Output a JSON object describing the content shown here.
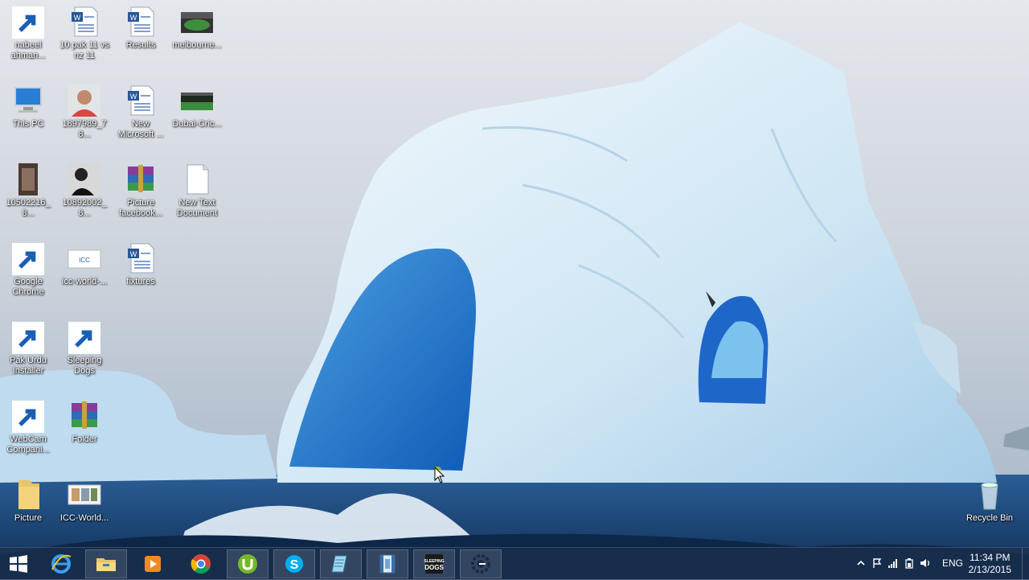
{
  "desktop": {
    "icons": [
      {
        "label": "nabeel\nahman...",
        "icon": "user-folder-icon"
      },
      {
        "label": "10 pak 11 vs\nnz 11",
        "icon": "word-document-icon"
      },
      {
        "label": "Results",
        "icon": "word-document-icon"
      },
      {
        "label": "melbourne...",
        "icon": "stadium-image-icon"
      },
      {
        "label": "This PC",
        "icon": "computer-icon"
      },
      {
        "label": "1897989_78...",
        "icon": "photo-portrait-icon"
      },
      {
        "label": "New\nMicrosoft ...",
        "icon": "word-document-icon"
      },
      {
        "label": "Dubai-Cric...",
        "icon": "stadium-image-icon"
      },
      {
        "label": "10502216_8...",
        "icon": "photo-portrait-icon"
      },
      {
        "label": "10892002_8...",
        "icon": "photo-portrait-icon"
      },
      {
        "label": "Picture\nfacebook...",
        "icon": "winrar-archive-icon"
      },
      {
        "label": "New Text\nDocument",
        "icon": "text-document-icon"
      },
      {
        "label": "Google\nChrome",
        "icon": "chrome-icon"
      },
      {
        "label": "icc-world-...",
        "icon": "image-thumbnail-icon"
      },
      {
        "label": "fixtures",
        "icon": "word-document-icon"
      },
      {
        "label": "Pak Urdu\nInstaller",
        "icon": "installer-document-icon"
      },
      {
        "label": "Sleeping\nDogs",
        "icon": "sleeping-dogs-game-icon"
      },
      {
        "label": "WebCam\nCompani...",
        "icon": "webcam-icon"
      },
      {
        "label": "Folder",
        "icon": "winrar-archive-icon"
      },
      {
        "label": "Picture",
        "icon": "folder-icon"
      },
      {
        "label": "ICC-World...",
        "icon": "image-thumbnail-icon"
      },
      {
        "label": "Recycle Bin",
        "icon": "recycle-bin-icon"
      }
    ]
  },
  "taskbar": {
    "buttons": [
      {
        "name": "start-button",
        "icon": "windows-logo-icon"
      },
      {
        "name": "internet-explorer-button",
        "icon": "internet-explorer-icon"
      },
      {
        "name": "file-explorer-button",
        "icon": "file-explorer-icon"
      },
      {
        "name": "media-player-button",
        "icon": "media-player-icon"
      },
      {
        "name": "chrome-button",
        "icon": "chrome-icon"
      },
      {
        "name": "utorrent-button",
        "icon": "utorrent-icon"
      },
      {
        "name": "skype-button",
        "icon": "skype-icon"
      },
      {
        "name": "notepad-app-button",
        "icon": "notepad-icon"
      },
      {
        "name": "video-editor-button",
        "icon": "film-strip-icon"
      },
      {
        "name": "sleeping-dogs-button",
        "icon": "sleeping-dogs-game-icon"
      },
      {
        "name": "cheat-engine-button",
        "icon": "cheat-engine-icon"
      }
    ],
    "tray": {
      "language": "ENG",
      "time": "11:34 PM",
      "date": "2/13/2015",
      "icons": [
        "show-hidden-icons-arrow-icon",
        "action-center-flag-icon",
        "network-signal-icon",
        "power-icon",
        "volume-icon"
      ]
    }
  },
  "colors": {
    "taskbar": "#1c304e",
    "accent": "#2a6fb5"
  }
}
